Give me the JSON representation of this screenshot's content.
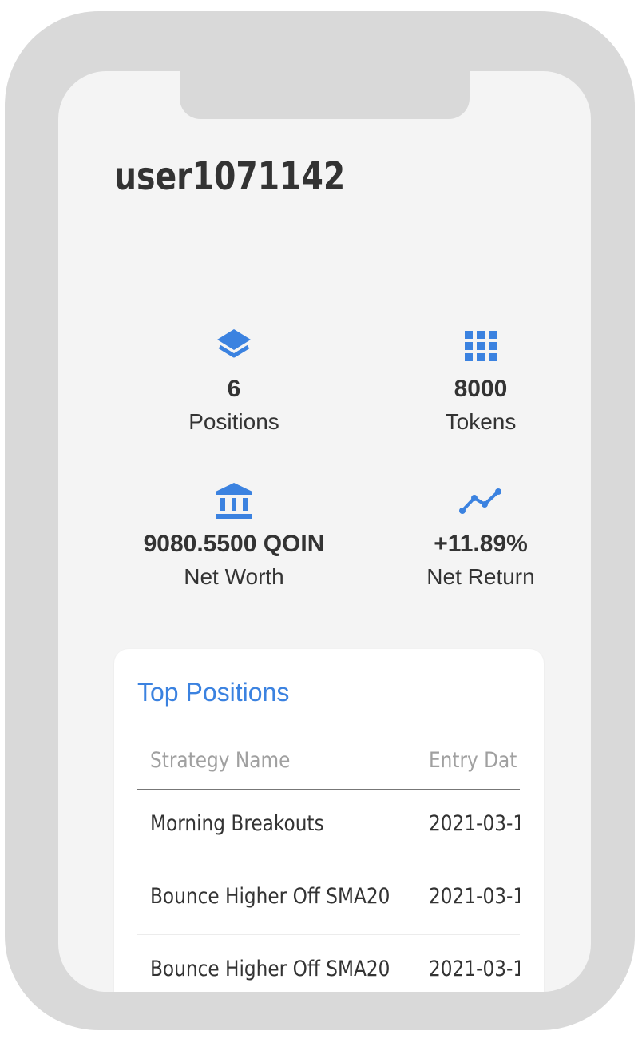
{
  "profile": {
    "username": "user1071142"
  },
  "stats": {
    "positions": {
      "value": "6",
      "label": "Positions",
      "icon": "layers-icon"
    },
    "tokens": {
      "value": "8000",
      "label": "Tokens",
      "icon": "grid-icon"
    },
    "net_worth": {
      "value": "9080.5500 QOIN",
      "label": "Net Worth",
      "icon": "bank-icon"
    },
    "net_return": {
      "value": "+11.89%",
      "label": "Net Return",
      "icon": "trend-line-icon"
    }
  },
  "top_positions": {
    "title": "Top Positions",
    "headers": [
      "Strategy Name",
      "Entry Dat"
    ],
    "rows": [
      {
        "strategy": "Morning Breakouts",
        "entry_date": "2021-03-1"
      },
      {
        "strategy": "Bounce Higher Off SMA20",
        "entry_date": "2021-03-1"
      },
      {
        "strategy": "Bounce Higher Off SMA20",
        "entry_date": "2021-03-1"
      }
    ]
  },
  "colors": {
    "accent": "#3b82e0",
    "text": "#333333",
    "muted": "#a0a0a0",
    "frame": "#d9d9d9",
    "screen": "#f4f4f4"
  }
}
